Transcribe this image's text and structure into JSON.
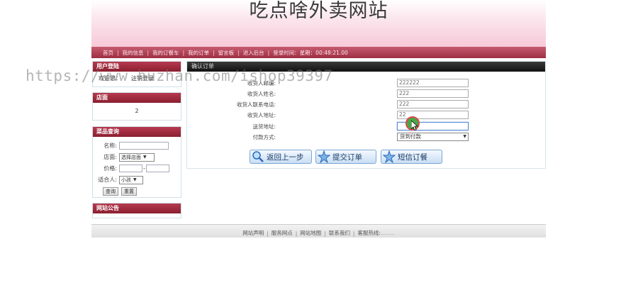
{
  "site": {
    "title": "吃点啥外卖网站"
  },
  "nav": {
    "items": [
      "首页",
      "我的信息",
      "我的订餐车",
      "我的订单",
      "留言板",
      "进入后台"
    ],
    "time_label": "登录时间：",
    "time_value": "星期：00:48:21.00"
  },
  "watermark": "https://www.huzhan.com/ishop39397",
  "sidebar": {
    "login": {
      "header": "用户登陆",
      "text": "欢迎您：",
      "logout": "注销登录"
    },
    "shop": {
      "header": "店面",
      "value": "2"
    },
    "search": {
      "header": "菜品查询",
      "name_label": "名称:",
      "shop_label": "店面:",
      "shop_select": "选择店面",
      "price_label": "价格:",
      "price_sep": "-",
      "for_label": "适合人:",
      "for_select": "小孩",
      "query_button": "查询",
      "reset_button": "重置"
    },
    "notice": {
      "header": "网站公告"
    }
  },
  "order": {
    "header": "确认订单",
    "fields": [
      {
        "label": "收货人邮编:",
        "value": "222222"
      },
      {
        "label": "收货人姓名:",
        "value": "222"
      },
      {
        "label": "收货人联系电话:",
        "value": "222"
      },
      {
        "label": "收货人地址:",
        "value": "22"
      },
      {
        "label": "送货地址:",
        "value": ""
      }
    ],
    "payment_label": "付款方式:",
    "payment_value": "货到付款",
    "buttons": {
      "back": "返回上一步",
      "submit": "提交订单",
      "sms": "短信订餐"
    }
  },
  "footer": {
    "links": [
      "网站声明",
      "服务网点",
      "网站地图",
      "联系我们"
    ],
    "hotline_label": "客服热线:",
    "hotline_value": "-----------"
  },
  "colors": {
    "nav": "#9e2f43",
    "panel_header": "#8a1f30",
    "main_header": "#111111",
    "button_border": "#7ba7d4"
  }
}
